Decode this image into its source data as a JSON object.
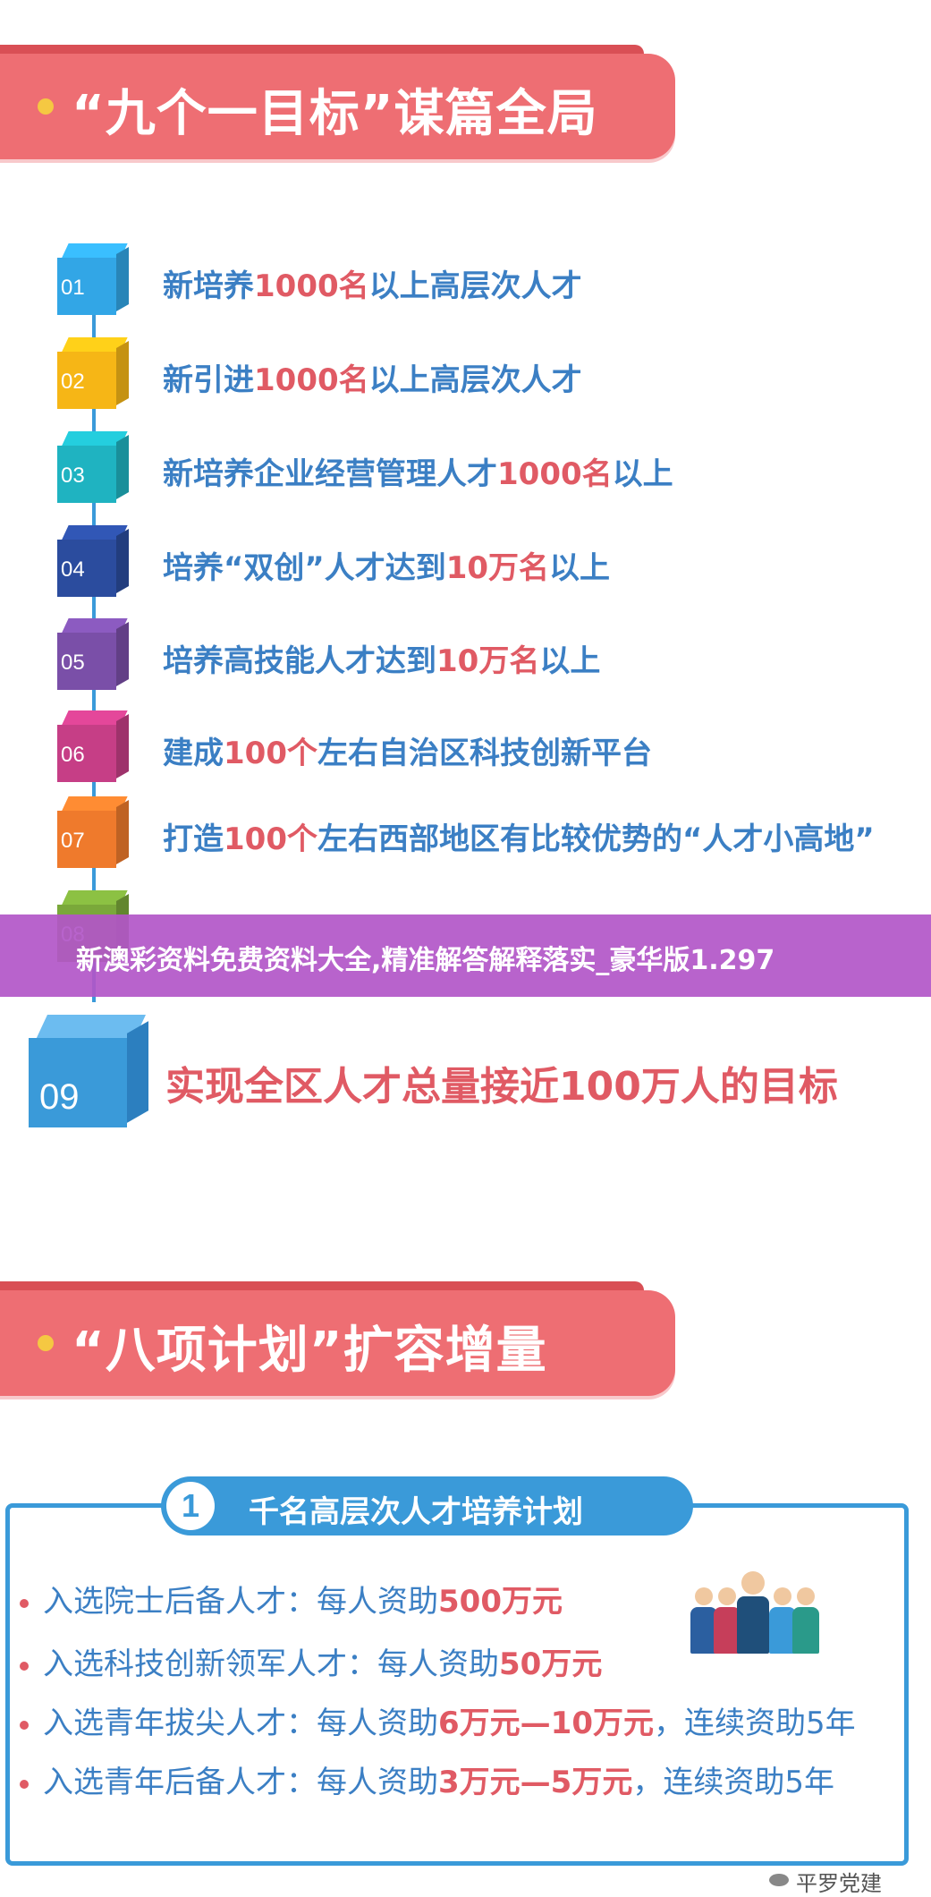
{
  "sections": {
    "s1_title": "“九个一目标”谋篇全局",
    "s2_title": "“八项计划”扩容增量"
  },
  "items": [
    {
      "num": "01",
      "color": "#32a6e6",
      "pre": "新培养",
      "hl": "1000名",
      "post": "以上高层次人才"
    },
    {
      "num": "02",
      "color": "#f6b616",
      "pre": "新引进",
      "hl": "1000名",
      "post": "以上高层次人才"
    },
    {
      "num": "03",
      "color": "#1fb3c1",
      "pre": "新培养企业经营管理人才",
      "hl": "1000名",
      "post": "以上"
    },
    {
      "num": "04",
      "color": "#2b4c9e",
      "pre": "培养“双创”人才达到",
      "hl": "10万名",
      "post": "以上"
    },
    {
      "num": "05",
      "color": "#7a4fa8",
      "pre": "培养高技能人才达到",
      "hl": "10万名",
      "post": "以上"
    },
    {
      "num": "06",
      "color": "#c63e86",
      "pre": "建成",
      "hl": "100个",
      "post": "左右自治区科技创新平台"
    },
    {
      "num": "07",
      "color": "#ef7a2c",
      "pre": "打造",
      "hl": "100个",
      "post": "左右西部地区有比较优势的“人才小高地”"
    },
    {
      "num": "08",
      "color": "#7aa83a",
      "pre": "",
      "hl": "",
      "post": ""
    }
  ],
  "goal": {
    "num": "09",
    "text": "实现全区人才总量接近100万人的目标"
  },
  "watermark": "新澳彩资料免费资料大全,精准解答解释落实_豪华版1.297",
  "plan": {
    "number": "1",
    "title": "千名高层次人才培养计划",
    "bullets": [
      {
        "pre": "入选院士后备人才：每人资助",
        "hl": "500万元",
        "post": ""
      },
      {
        "pre": "入选科技创新领军人才：每人资助",
        "hl": "50万元",
        "post": ""
      },
      {
        "pre": "入选青年拔尖人才：每人资助",
        "hl": "6万元—10万元",
        "post": "，连续资助5年"
      },
      {
        "pre": "入选青年后备人才：每人资助",
        "hl": "3万元—5万元",
        "post": "，连续资助5年"
      }
    ]
  },
  "footer": "平罗党建"
}
